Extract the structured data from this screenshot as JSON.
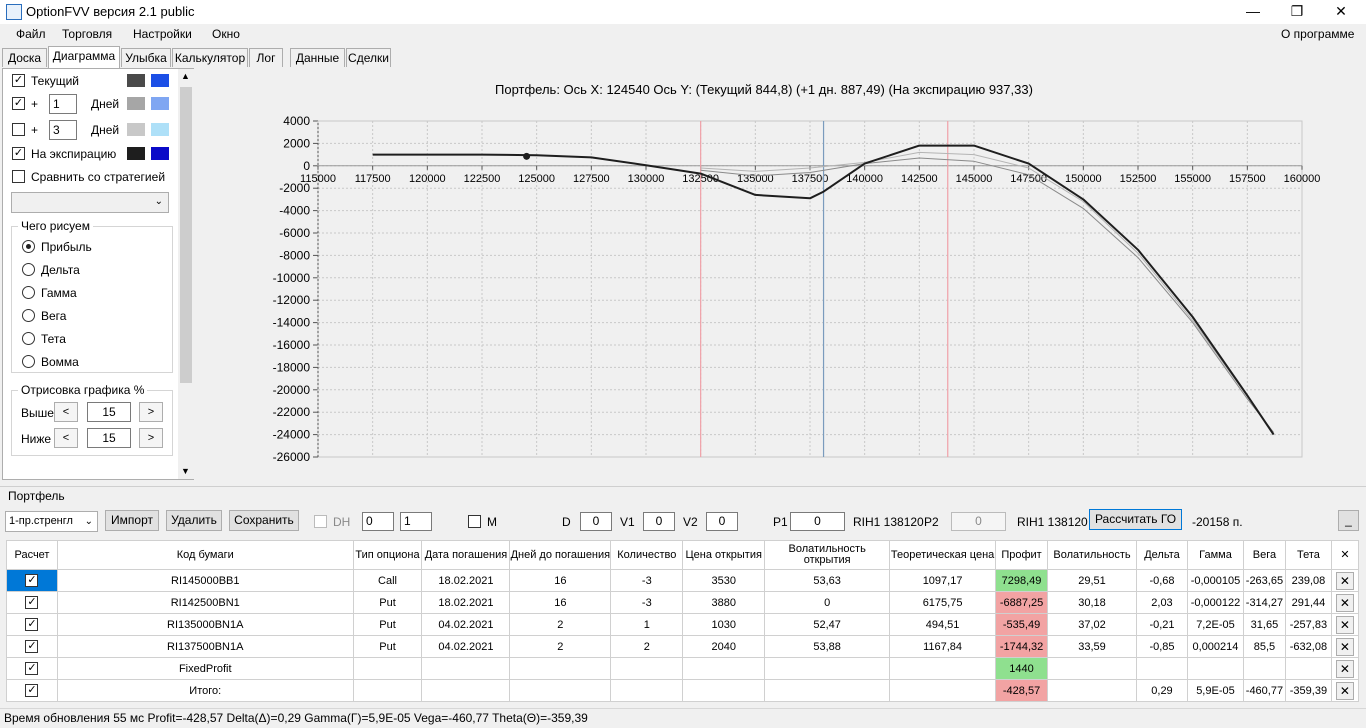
{
  "window": {
    "title": "OptionFVV версия 2.1 public",
    "minimize": "—",
    "maximize": "❐",
    "close": "✕"
  },
  "menu": {
    "items": [
      "Файл",
      "Торговля",
      "Настройки",
      "Окно"
    ],
    "about": "О программе"
  },
  "tabs": [
    "Доска",
    "Диаграмма",
    "Улыбка",
    "Калькулятор",
    "Лог",
    "Данные",
    "Сделки"
  ],
  "left_panel": {
    "current_label": "Текущий",
    "plus": "+",
    "days1_value": "1",
    "days2_value": "3",
    "days_label": "Дней",
    "expiration_label": "На экспирацию",
    "compare_label": "Сравнить со стратегией",
    "draw_group_title": "Чего рисуем",
    "radios": [
      "Прибыль",
      "Дельта",
      "Гамма",
      "Вега",
      "Тета",
      "Вомма"
    ],
    "render_group_title": "Отрисовка графика %",
    "above_label": "Выше",
    "below_label": "Ниже",
    "above_value": "15",
    "below_value": "15",
    "spin_left": "<",
    "spin_right": ">",
    "colors": {
      "current": [
        "#4a4a4a",
        "#1c4fe6"
      ],
      "days1": [
        "#a6a6a6",
        "#7fa6f2"
      ],
      "days2": [
        "#c8c8c8",
        "#aee0f8"
      ],
      "expiration": [
        "#1e1e1e",
        "#0a0ac8"
      ]
    },
    "checked": "✓"
  },
  "chart_title": "Портфель:  Ось X:  124540  Ось Y:   (Текущий 844,8)   (+1 дн.  887,49)   (На экспирацию  937,33)",
  "chart_data": {
    "type": "line",
    "title": "Портфель:  Ось X:  124540  Ось Y:   (Текущий 844,8)   (+1 дн.  887,49)   (На экспирацию  937,33)",
    "xlim": [
      115000,
      160000
    ],
    "ylim": [
      -26000,
      4000
    ],
    "x_ticks": [
      "115000",
      "117500",
      "120000",
      "122500",
      "125000",
      "127500",
      "130000",
      "132500",
      "135000",
      "137500",
      "140000",
      "142500",
      "145000",
      "147500",
      "150000",
      "152500",
      "155000",
      "157500",
      "160000"
    ],
    "y_ticks": [
      "4000",
      "2000",
      "0",
      "-2000",
      "-4000",
      "-6000",
      "-8000",
      "-10000",
      "-12000",
      "-14000",
      "-16000",
      "-18000",
      "-20000",
      "-22000",
      "-24000",
      "-26000"
    ],
    "vertical_lines": [
      {
        "x": 132500,
        "color": "#f0a0a8"
      },
      {
        "x": 138120,
        "color": "#7a9bbd"
      },
      {
        "x": 143800,
        "color": "#f0a0a8"
      }
    ],
    "marker": {
      "x": 124540,
      "y": 845
    },
    "series": [
      {
        "color": "#1e1e1e",
        "width": 2,
        "points": [
          [
            117500,
            1000
          ],
          [
            120000,
            1000
          ],
          [
            122500,
            1000
          ],
          [
            125000,
            950
          ],
          [
            127500,
            750
          ],
          [
            130000,
            50
          ],
          [
            132500,
            -700
          ],
          [
            135000,
            -2600
          ],
          [
            137500,
            -2900
          ],
          [
            138120,
            -2300
          ],
          [
            140000,
            200
          ],
          [
            142500,
            1800
          ],
          [
            145000,
            1800
          ],
          [
            147500,
            200
          ],
          [
            150000,
            -3000
          ],
          [
            152500,
            -7500
          ],
          [
            155000,
            -13500
          ],
          [
            157500,
            -20500
          ],
          [
            158700,
            -24000
          ]
        ]
      },
      {
        "color": "#8a8a8a",
        "width": 1,
        "points": [
          [
            132500,
            -400
          ],
          [
            135000,
            -900
          ],
          [
            137500,
            -600
          ],
          [
            140000,
            200
          ],
          [
            142500,
            700
          ],
          [
            145000,
            400
          ],
          [
            147500,
            -800
          ],
          [
            150000,
            -3800
          ],
          [
            152500,
            -8200
          ],
          [
            155000,
            -14000
          ],
          [
            157500,
            -20800
          ],
          [
            158700,
            -23800
          ]
        ]
      },
      {
        "color": "#b4b4b4",
        "width": 1,
        "points": [
          [
            132500,
            -200
          ],
          [
            135000,
            -500
          ],
          [
            137500,
            -200
          ],
          [
            140000,
            300
          ],
          [
            142500,
            1200
          ],
          [
            145000,
            1000
          ],
          [
            147500,
            -200
          ],
          [
            150000,
            -3200
          ],
          [
            152500,
            -7800
          ],
          [
            155000,
            -13800
          ],
          [
            157500,
            -20600
          ],
          [
            158700,
            -23900
          ]
        ]
      }
    ]
  },
  "portfolio": {
    "label": "Портфель",
    "strategy_select": "1-пр.стренгл",
    "import": "Импорт",
    "delete": "Удалить",
    "save": "Сохранить",
    "dh_label": "DH",
    "spin1": "0",
    "spin2": "1",
    "m_label": "M",
    "d_label": "D",
    "d_value": "0",
    "v1_label": "V1",
    "v1_value": "0",
    "v2_label": "V2",
    "v2_value": "0",
    "p1_label": "P1",
    "p1_value": "0",
    "rih1": "RIH1 138120",
    "p2_label": "P2",
    "p2_value": "0",
    "rih1b": "RIH1 138120",
    "calc_go": "Рассчитать ГО",
    "go_value": "-20158 п.",
    "minimize_btn": "_"
  },
  "table": {
    "headers": [
      "Расчет",
      "Код бумаги",
      "Тип опциона",
      "Дата погашения",
      "Дней до погашения",
      "Количество",
      "Цена открытия",
      "Волатильность открытия",
      "Теоретическая цена",
      "Профит",
      "Волатильность",
      "Дельта",
      "Гамма",
      "Вега",
      "Тета",
      "✕"
    ],
    "rows": [
      [
        "✓",
        "RI145000BB1",
        "Call",
        "18.02.2021",
        "16",
        "-3",
        "3530",
        "53,63",
        "1097,17",
        "7298,49",
        "29,51",
        "-0,68",
        "-0,000105",
        "-263,65",
        "239,08",
        "✕"
      ],
      [
        "✓",
        "RI142500BN1",
        "Put",
        "18.02.2021",
        "16",
        "-3",
        "3880",
        "0",
        "6175,75",
        "-6887,25",
        "30,18",
        "2,03",
        "-0,000122",
        "-314,27",
        "291,44",
        "✕"
      ],
      [
        "✓",
        "RI135000BN1A",
        "Put",
        "04.02.2021",
        "2",
        "1",
        "1030",
        "52,47",
        "494,51",
        "-535,49",
        "37,02",
        "-0,21",
        "7,2E-05",
        "31,65",
        "-257,83",
        "✕"
      ],
      [
        "✓",
        "RI137500BN1A",
        "Put",
        "04.02.2021",
        "2",
        "2",
        "2040",
        "53,88",
        "1167,84",
        "-1744,32",
        "33,59",
        "-0,85",
        "0,000214",
        "85,5",
        "-632,08",
        "✕"
      ],
      [
        "✓",
        "FixedProfit",
        "",
        "",
        "",
        "",
        "",
        "",
        "",
        "1440",
        "",
        "",
        "",
        "",
        "",
        "✕"
      ],
      [
        "✓",
        "Итого:",
        "",
        "",
        "",
        "",
        "",
        "",
        "",
        "-428,57",
        "",
        "0,29",
        "5,9E-05",
        "-460,77",
        "-359,39",
        "✕"
      ]
    ]
  },
  "status": "Время обновления 55 мс  Profit=-428,57 Delta(Δ)=0,29 Gamma(Γ)=5,9E-05 Vega=-460,77 Theta(Θ)=-359,39"
}
